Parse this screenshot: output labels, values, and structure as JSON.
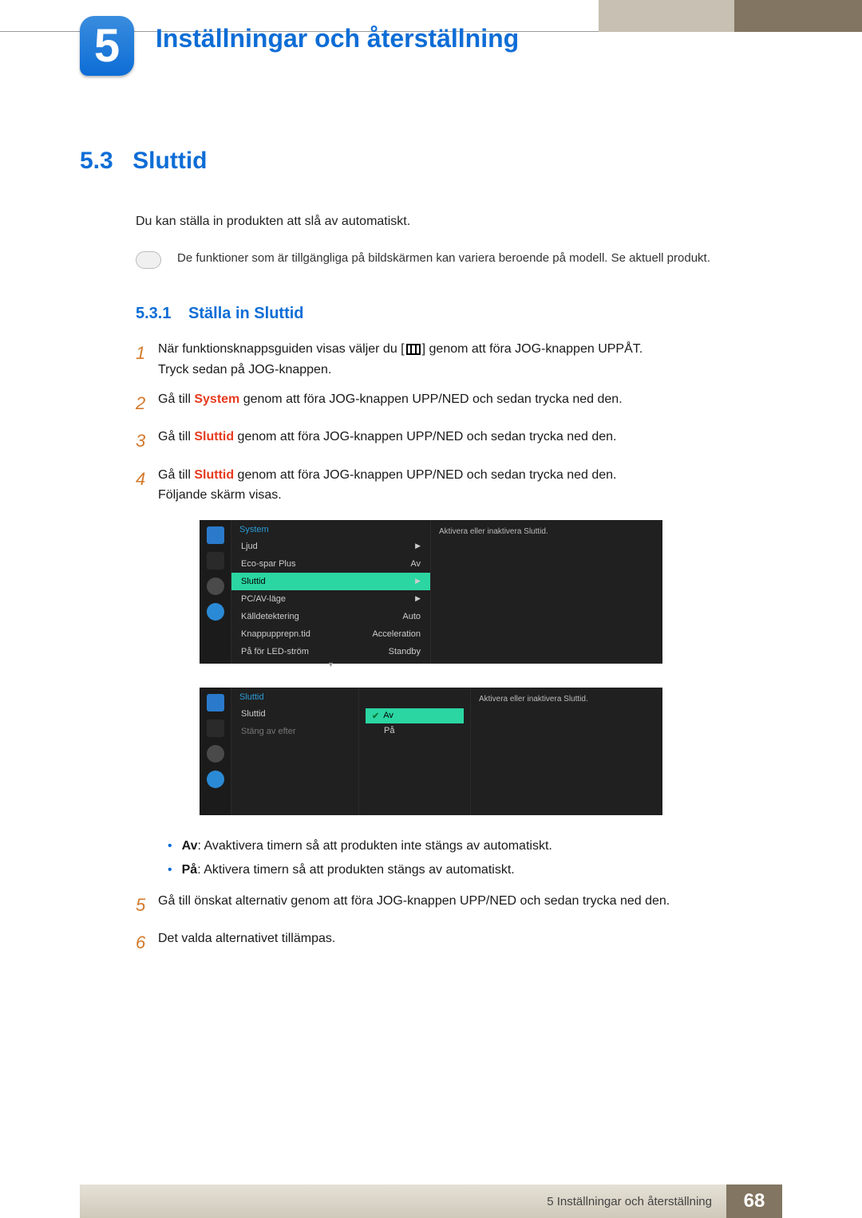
{
  "chapter": {
    "number": "5",
    "title": "Inställningar och återställning"
  },
  "section53": {
    "num": "5.3",
    "title": "Sluttid",
    "intro": "Du kan ställa in produkten att slå av automatiskt.",
    "note": "De funktioner som är tillgängliga på bildskärmen kan variera beroende på modell. Se aktuell produkt."
  },
  "section531": {
    "num": "5.3.1",
    "title": "Ställa in Sluttid"
  },
  "steps": {
    "s1a": "När funktionsknappsguiden visas väljer du [",
    "s1b": "] genom att föra JOG-knappen UPPÅT.",
    "s1c": "Tryck sedan på JOG-knappen.",
    "s2a": "Gå till ",
    "s2_system": "System",
    "s2b": " genom att föra JOG-knappen UPP/NED och sedan trycka ned den.",
    "s3a": "Gå till ",
    "s3_sluttid": "Sluttid",
    "s3b": " genom att föra JOG-knappen UPP/NED och sedan trycka ned den.",
    "s4a": "Gå till ",
    "s4_sluttid": "Sluttid",
    "s4b": " genom att föra JOG-knappen UPP/NED och sedan trycka ned den.",
    "s4c": "Följande skärm visas.",
    "s5": "Gå till önskat alternativ genom att föra JOG-knappen UPP/NED och sedan trycka ned den.",
    "s6": "Det valda alternativet tillämpas.",
    "n1": "1",
    "n2": "2",
    "n3": "3",
    "n4": "4",
    "n5": "5",
    "n6": "6"
  },
  "osd1": {
    "head": "System",
    "help": "Aktivera eller inaktivera Sluttid.",
    "rows": {
      "ljud": "Ljud",
      "eco": "Eco-spar Plus",
      "eco_v": "Av",
      "sluttid": "Sluttid",
      "pcav": "PC/AV-läge",
      "kall": "Källdetektering",
      "kall_v": "Auto",
      "knapp": "Knappupprepn.tid",
      "knapp_v": "Acceleration",
      "led": "På för LED-ström",
      "led_v": "Standby"
    }
  },
  "osd2": {
    "head": "Sluttid",
    "help": "Aktivera eller inaktivera Sluttid.",
    "left": {
      "sluttid": "Sluttid",
      "stang": "Stäng av efter"
    },
    "opts": {
      "av": "Av",
      "pa": "På"
    }
  },
  "options": {
    "av_label": "Av",
    "av_text": ": Avaktivera timern så att produkten inte stängs av automatiskt.",
    "pa_label": "På",
    "pa_text": ": Aktivera timern så att produkten stängs av automatiskt."
  },
  "footer": {
    "chapter": "5 Inställningar och återställning",
    "page": "68"
  }
}
